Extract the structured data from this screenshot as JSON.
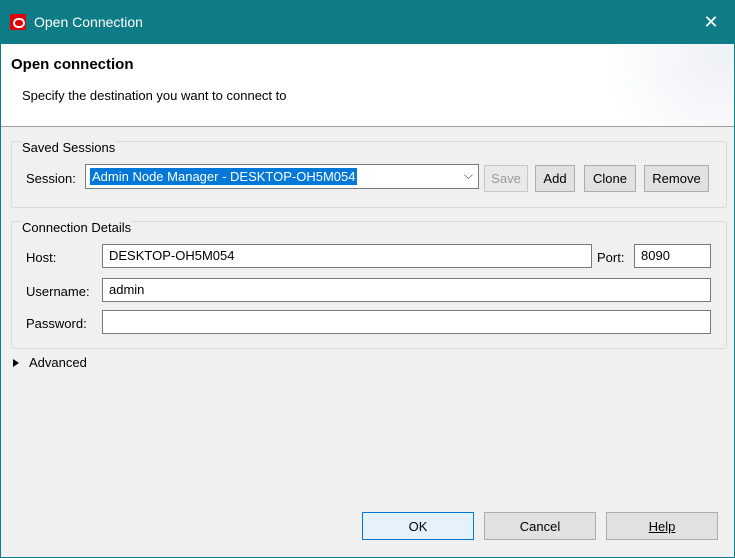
{
  "window": {
    "title": "Open Connection"
  },
  "header": {
    "title": "Open connection",
    "subtitle": "Specify the destination you want to connect to"
  },
  "saved_sessions": {
    "group_label": "Saved Sessions",
    "session_label": "Session:",
    "session_value": "Admin Node Manager - DESKTOP-OH5M054",
    "buttons": {
      "save": "Save",
      "add": "Add",
      "clone": "Clone",
      "remove": "Remove"
    }
  },
  "connection_details": {
    "group_label": "Connection Details",
    "host_label": "Host:",
    "host_value": "DESKTOP-OH5M054",
    "port_label": "Port:",
    "port_value": "8090",
    "username_label": "Username:",
    "username_value": "admin",
    "password_label": "Password:",
    "password_value": ""
  },
  "advanced": {
    "label": "Advanced",
    "expanded": false
  },
  "footer": {
    "ok": "OK",
    "cancel": "Cancel",
    "help": "Help"
  },
  "colors": {
    "titlebar": "#0e7c86",
    "selection": "#0078d7",
    "app_icon": "#e30000"
  },
  "icons": {
    "app": "oracle-icon",
    "close": "close-icon",
    "dropdown": "chevron-down-icon",
    "expander": "triangle-right-icon"
  }
}
